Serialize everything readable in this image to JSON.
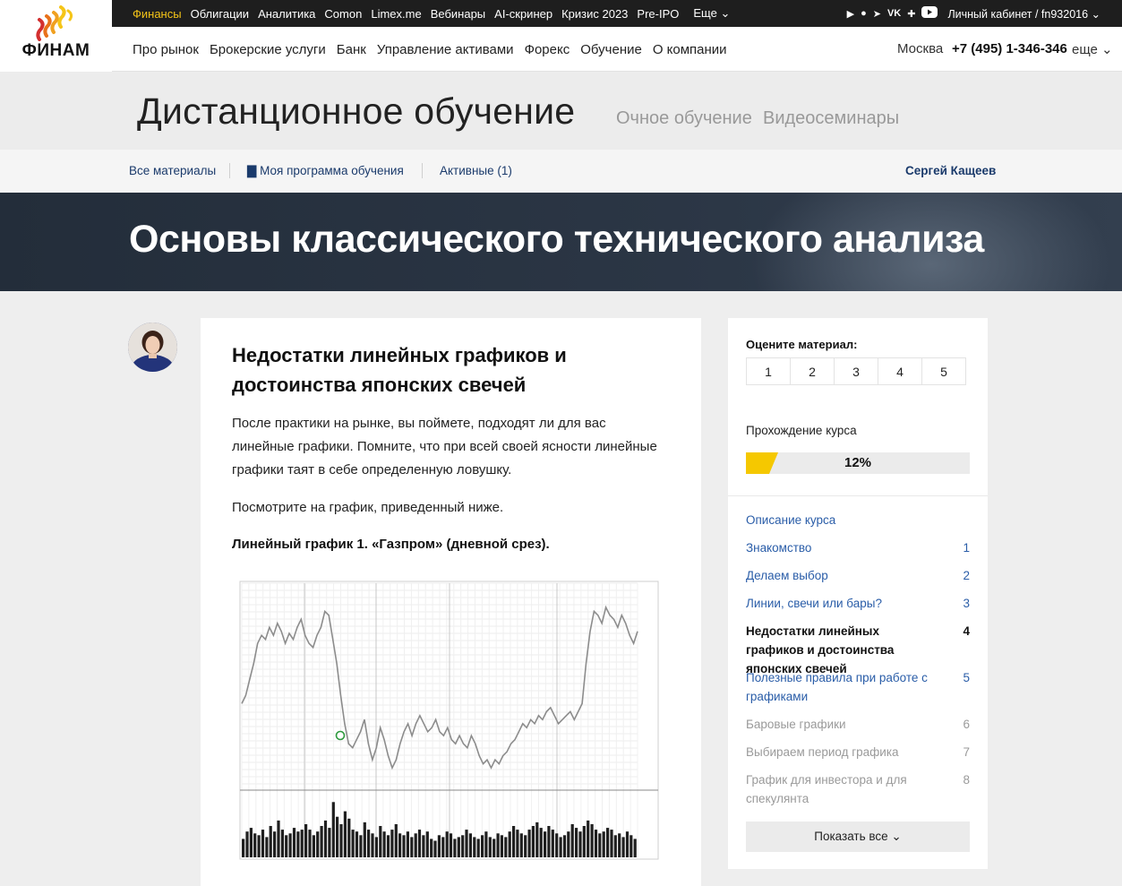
{
  "topbar": {
    "links": [
      "Финансы",
      "Облигации",
      "Аналитика",
      "Comon",
      "Limex.me",
      "Вебинары",
      "AI-скринер",
      "Кризис 2023",
      "Pre-IPO"
    ],
    "more_label": "Еще ⌄",
    "social_icons": [
      "play-icon",
      "apple-icon",
      "telegram-icon",
      "vk-icon",
      "okru-icon",
      "youtube-icon"
    ],
    "cabinet_label": "Личный кабинет / fn932016 ⌄"
  },
  "logo": {
    "text": "ФИНАМ",
    "colors": [
      "#f5c518",
      "#e8711a",
      "#d32f2f"
    ]
  },
  "nav": {
    "items": [
      "Про рынок",
      "Брокерские услуги",
      "Банк",
      "Управление активами",
      "Форекс",
      "Обучение",
      "О компании"
    ],
    "city": "Москва",
    "phone": "+7 (495) 1-346-346",
    "more_label": "еще ⌄"
  },
  "section": {
    "title": "Дистанционное обучение",
    "alt_links": [
      "Очное обучение",
      "Видеосеминары"
    ]
  },
  "subnav": {
    "all_materials": "Все материалы",
    "my_program": "Моя программа обучения",
    "active": "Активные (1)",
    "user": "Сергей Кащеев"
  },
  "course": {
    "title": "Основы классического технического анализа"
  },
  "article": {
    "heading": "Недостатки линейных графиков и достоинства японских свечей",
    "paragraph1": "После практики на рынке, вы поймете, подходят ли для вас линейные графики. Помните, что при всей своей ясности линейные графики таят в себе определенную ловушку.",
    "paragraph2": "Посмотрите на график, приведенный ниже.",
    "caption": "Линейный график 1. «Газпром» (дневной срез)."
  },
  "sidebar": {
    "rate_title": "Оцените материал:",
    "rate_options": [
      "1",
      "2",
      "3",
      "4",
      "5"
    ],
    "progress_title": "Прохождение курса",
    "progress_value": "12%",
    "progress_fraction": 0.12,
    "lessons": [
      {
        "title": "Описание курса",
        "num": "",
        "state": "available"
      },
      {
        "title": "Знакомство",
        "num": "1",
        "state": "available"
      },
      {
        "title": "Делаем выбор",
        "num": "2",
        "state": "available"
      },
      {
        "title": "Линии, свечи или бары?",
        "num": "3",
        "state": "available"
      },
      {
        "title": "Недостатки линейных графиков и достоинства японских свечей",
        "num": "4",
        "state": "current"
      },
      {
        "title": "Полезные правила при работе с графиками",
        "num": "5",
        "state": "available"
      },
      {
        "title": "Баровые графики",
        "num": "6",
        "state": "locked"
      },
      {
        "title": "Выбираем период графика",
        "num": "7",
        "state": "locked"
      },
      {
        "title": "График для инвестора и для спекулянта",
        "num": "8",
        "state": "locked"
      }
    ],
    "show_all": "Показать все ⌄"
  },
  "chart_data": {
    "type": "line",
    "title": "",
    "xlabel": "",
    "ylabel": "",
    "series": [
      {
        "values": [
          40,
          44,
          52,
          60,
          70,
          74,
          72,
          78,
          74,
          80,
          76,
          70,
          75,
          72,
          78,
          82,
          74,
          70,
          68,
          74,
          78,
          86,
          84,
          72,
          60,
          44,
          30,
          20,
          18,
          22,
          26,
          32,
          20,
          12,
          18,
          28,
          22,
          14,
          8,
          12,
          20,
          26,
          30,
          24,
          30,
          34,
          30,
          26,
          28,
          32,
          26,
          24,
          28,
          22,
          20,
          24,
          20,
          18,
          24,
          20,
          14,
          10,
          12,
          8,
          12,
          10,
          14,
          16,
          20,
          22,
          26,
          30,
          28,
          32,
          30,
          34,
          32,
          36,
          38,
          34,
          30,
          32,
          34,
          36,
          32,
          36,
          40,
          60,
          76,
          86,
          84,
          80,
          88,
          84,
          82,
          78,
          84,
          80,
          74,
          70,
          76
        ]
      },
      {
        "values": [
          20,
          28,
          32,
          26,
          24,
          30,
          22,
          34,
          28,
          40,
          30,
          24,
          26,
          32,
          28,
          30,
          36,
          30,
          24,
          28,
          34,
          40,
          32,
          60,
          44,
          36,
          50,
          42,
          30,
          28,
          24,
          38,
          30,
          26,
          22,
          34,
          28,
          24,
          30,
          36,
          26,
          24,
          28,
          22,
          26,
          30,
          24,
          28,
          20,
          18,
          24,
          22,
          28,
          26,
          20,
          22,
          24,
          30,
          26,
          22,
          20,
          24,
          28,
          22,
          20,
          26,
          24,
          22,
          28,
          34,
          30,
          26,
          24,
          30,
          34,
          38,
          32,
          28,
          34,
          30,
          26,
          22,
          24,
          28,
          36,
          32,
          28,
          34,
          40,
          36,
          30,
          26,
          28,
          32,
          30,
          24,
          26,
          22,
          28,
          24,
          20
        ]
      }
    ],
    "grid": true,
    "legend": "none"
  }
}
